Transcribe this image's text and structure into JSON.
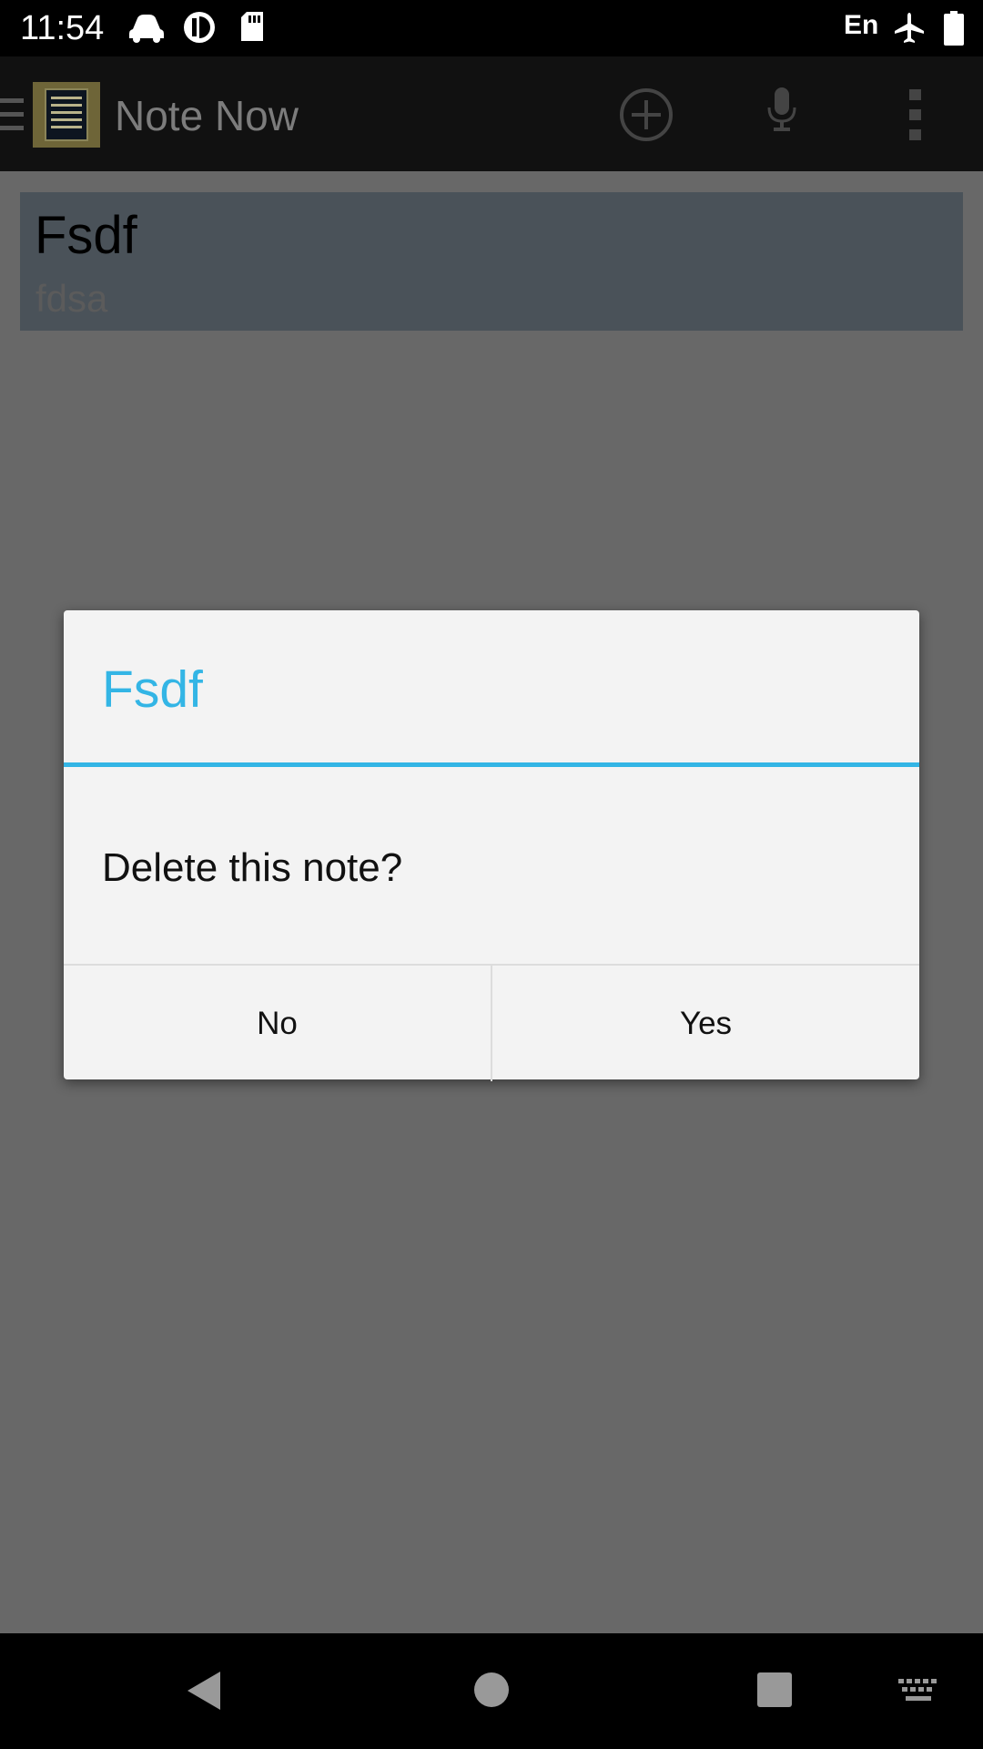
{
  "status_bar": {
    "time": "11:54",
    "language": "En",
    "icons": [
      "car-icon",
      "sync-icon",
      "sd-card-icon",
      "airplane-icon",
      "battery-icon"
    ]
  },
  "action_bar": {
    "title": "Note Now",
    "icons": [
      "menu-icon",
      "notepad-app-icon",
      "add-note-icon",
      "microphone-icon",
      "overflow-menu-icon"
    ]
  },
  "notes": [
    {
      "title": "Fsdf",
      "body": "fdsa"
    }
  ],
  "dialog": {
    "title": "Fsdf",
    "message": "Delete this note?",
    "negative_label": "No",
    "positive_label": "Yes",
    "accent_color": "#33b5e5"
  },
  "nav_bar": {
    "icons": [
      "back-icon",
      "home-icon",
      "recents-icon",
      "keyboard-icon"
    ]
  }
}
